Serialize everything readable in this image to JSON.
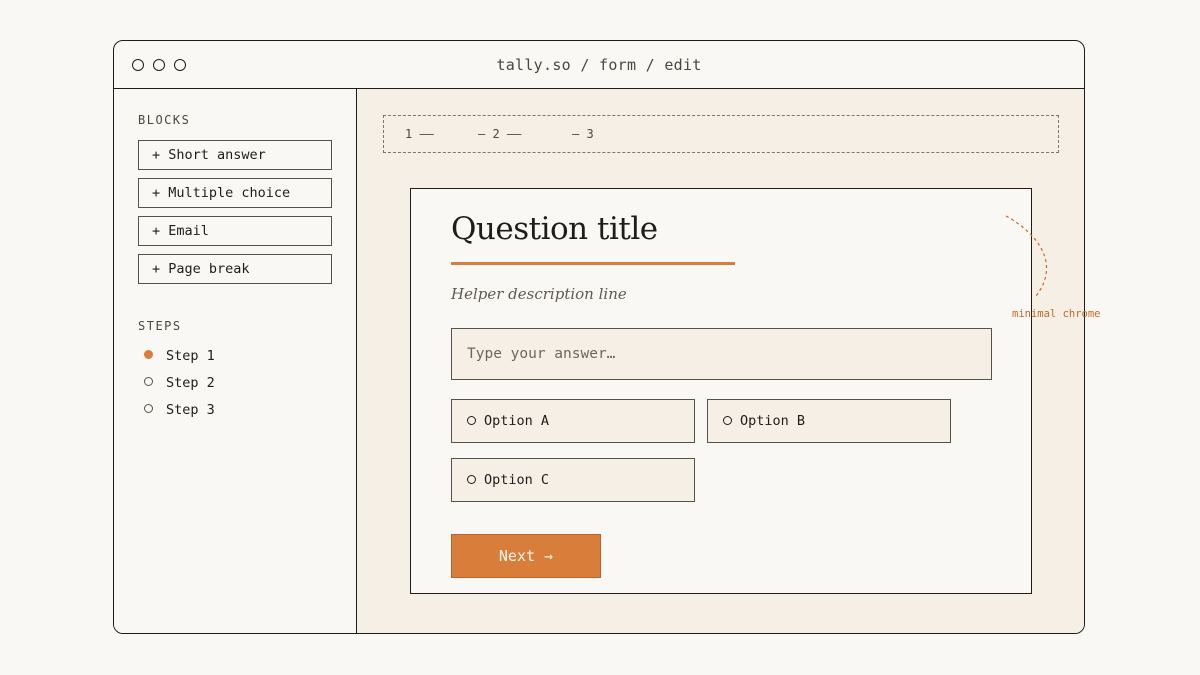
{
  "window": {
    "url": "tally.so / form / edit"
  },
  "sidebar": {
    "blocks_label": "BLOCKS",
    "blocks": [
      "+ Short answer",
      "+ Multiple choice",
      "+ Email",
      "+ Page break"
    ],
    "steps_label": "STEPS",
    "steps": [
      {
        "label": "Step 1",
        "active": true
      },
      {
        "label": "Step 2",
        "active": false
      },
      {
        "label": "Step 3",
        "active": false
      }
    ]
  },
  "progress": [
    "1 ——",
    "— 2 ——",
    "— 3"
  ],
  "form": {
    "title": "Question title",
    "helper": "Helper description line",
    "answer_placeholder": "Type your answer…",
    "options": [
      "Option A",
      "Option B",
      "Option C"
    ],
    "next_label": "Next →"
  },
  "annotation": "minimal chrome",
  "colors": {
    "accent": "#d97d3a",
    "canvas": "#f5efe6",
    "ink": "#1f1d1a"
  }
}
